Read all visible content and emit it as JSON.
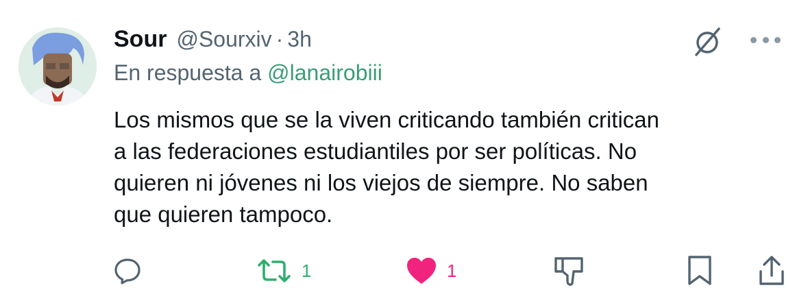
{
  "author": {
    "name": "Sour",
    "handle": "@Sourxiv",
    "separator": "·",
    "time": "3h"
  },
  "reply_to": {
    "prefix": "En respuesta a",
    "mention": "@lanairobiii"
  },
  "body": {
    "lines": [
      "Los mismos que se la viven criticando también critican",
      "a las federaciones estudiantiles por ser políticas. No",
      "quieren ni jóvenes ni los viejos de siempre. No saben",
      "que quieren tampoco."
    ]
  },
  "actions": {
    "retweet_count": "1",
    "like_count": "1"
  },
  "colors": {
    "text": "#0f1419",
    "secondary": "#536471",
    "mention": "#3b9c77",
    "retweet": "#2eae6e",
    "like": "#f0237f",
    "icon": "#536471"
  },
  "icons": [
    "grok-icon",
    "more-icon",
    "reply-icon",
    "retweet-icon",
    "like-icon",
    "dislike-icon",
    "bookmark-icon",
    "share-icon"
  ]
}
